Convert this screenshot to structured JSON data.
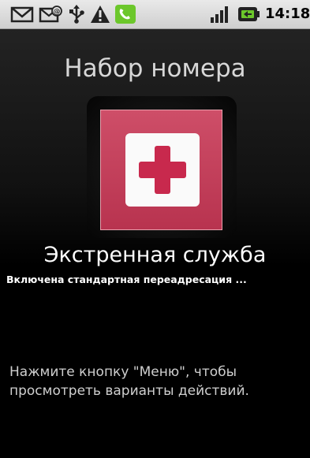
{
  "status_bar": {
    "icons": [
      "gmail-icon",
      "email-icon",
      "usb-icon",
      "warning-icon",
      "call-icon",
      "signal-icon",
      "battery-icon"
    ],
    "time": "14:18"
  },
  "screen": {
    "title": "Набор номера",
    "contact_name": "Экстренная служба",
    "forward_status": "Включена стандартная переадресация ...",
    "hint": "Нажмите кнопку \"Меню\", чтобы просмотреть варианты действий."
  },
  "colors": {
    "photo_red": "#ce4e68",
    "cross_red": "#c8294d",
    "call_green": "#6cc72b"
  }
}
